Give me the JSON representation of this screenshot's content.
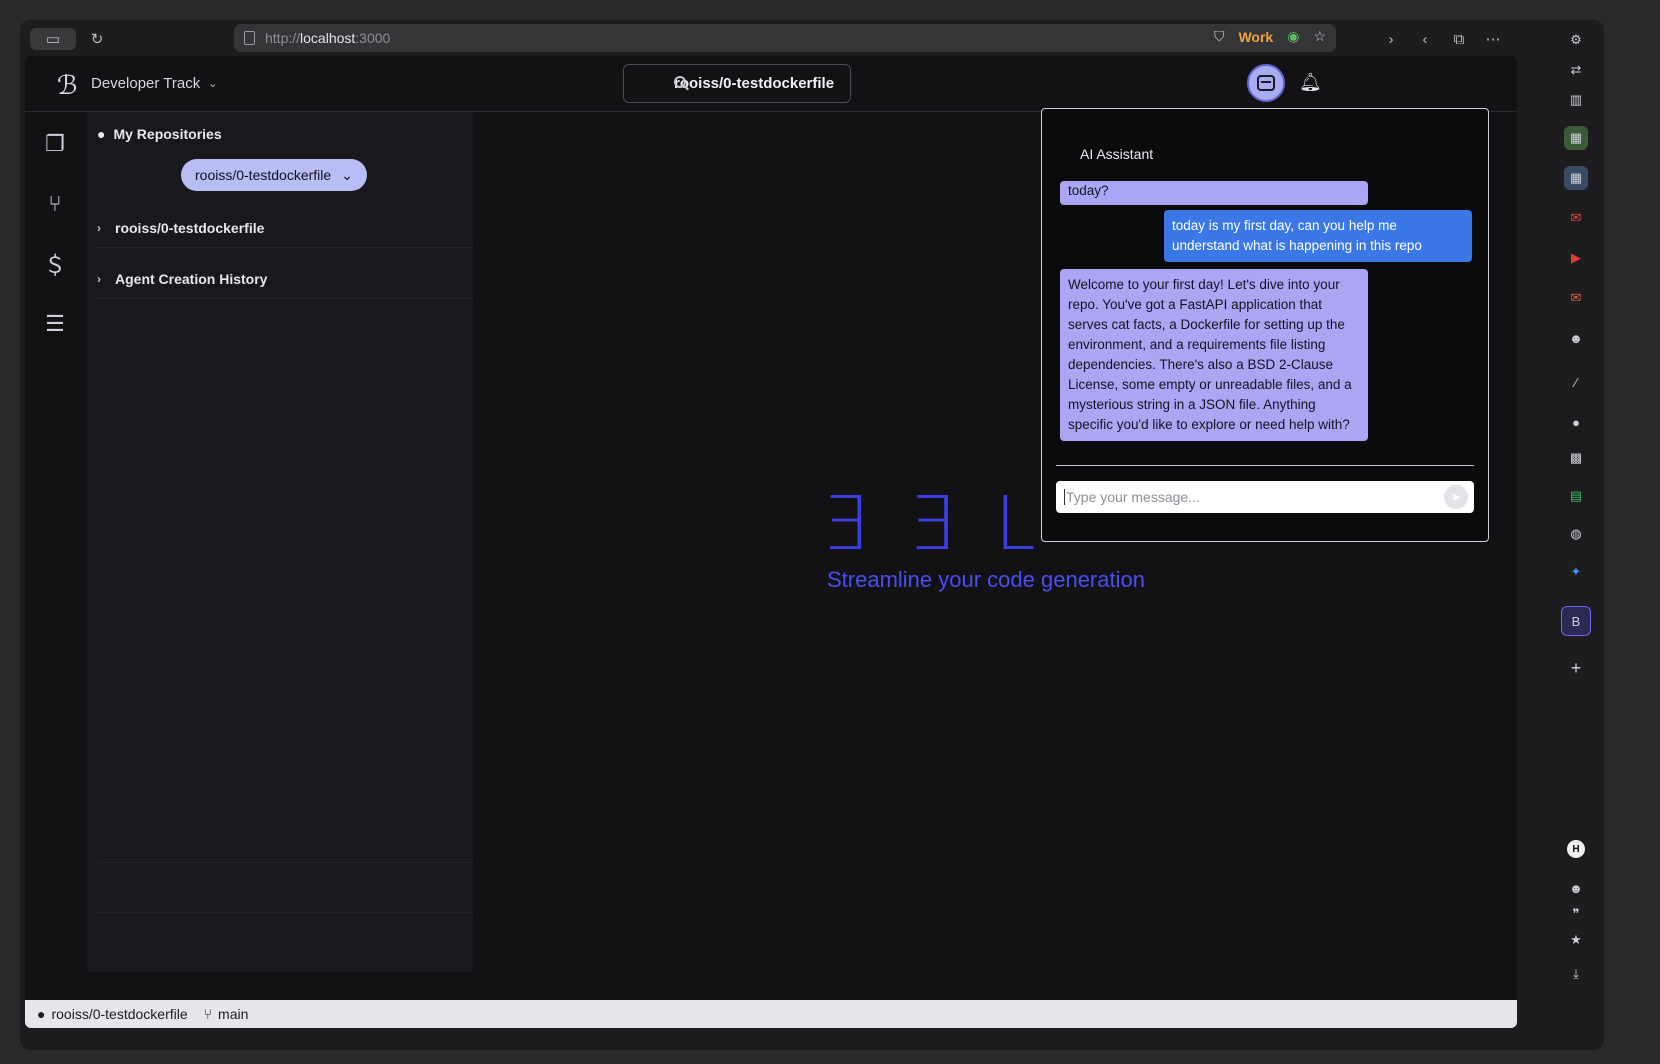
{
  "browser": {
    "url_prefix": "http://",
    "url_host": "localhost",
    "url_port": ":3000",
    "work_label": "Work"
  },
  "header": {
    "track_label": "Developer Track",
    "search_value": "rooiss/0-testdockerfile"
  },
  "sidebar": {
    "title": "My Repositories",
    "selected_repo": "rooiss/0-testdockerfile",
    "items": [
      {
        "label": "rooiss/0-testdockerfile"
      },
      {
        "label": "Agent Creation History"
      }
    ]
  },
  "hero": {
    "subtitle": "Streamline your code generation"
  },
  "chat": {
    "title": "AI Assistant",
    "messages": [
      {
        "role": "assistant",
        "text": "today?"
      },
      {
        "role": "user",
        "text": "today is my first day, can you help me understand what is happening in this repo"
      },
      {
        "role": "assistant",
        "text": "Welcome to your first day! Let's dive into your repo. You've got a FastAPI application that serves cat facts, a Dockerfile for setting up the environment, and a requirements file listing dependencies. There's also a BSD 2-Clause License, some empty or unreadable files, and a mysterious string in a JSON file. Anything specific you'd like to explore or need help with?"
      }
    ],
    "input_placeholder": "Type your message..."
  },
  "statusbar": {
    "repo": "rooiss/0-testdockerfile",
    "branch": "main"
  }
}
